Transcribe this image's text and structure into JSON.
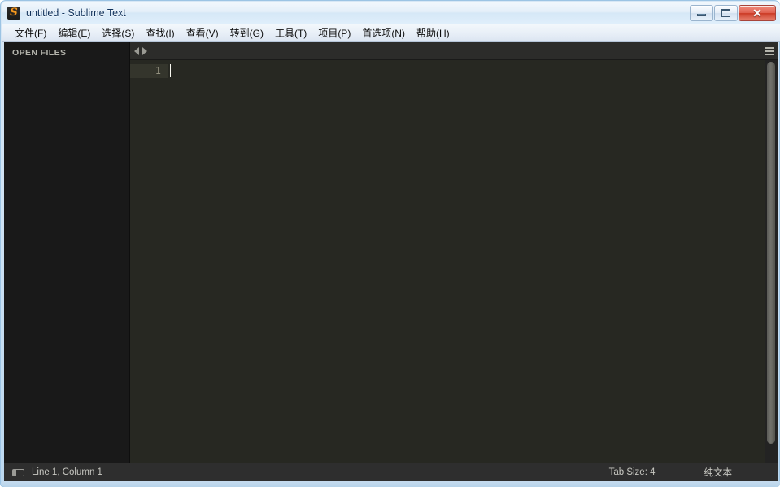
{
  "window": {
    "title": "untitled - Sublime Text",
    "app_icon": "sublime-text-logo",
    "controls": {
      "minimize_label": "–",
      "maximize_label": "□",
      "close_label": "✕"
    }
  },
  "menubar": {
    "items": [
      {
        "label": "文件(F)"
      },
      {
        "label": "编辑(E)"
      },
      {
        "label": "选择(S)"
      },
      {
        "label": "查找(I)"
      },
      {
        "label": "查看(V)"
      },
      {
        "label": "转到(G)"
      },
      {
        "label": "工具(T)"
      },
      {
        "label": "项目(P)"
      },
      {
        "label": "首选项(N)"
      },
      {
        "label": "帮助(H)"
      }
    ]
  },
  "sidebar": {
    "header": "OPEN FILES",
    "items": []
  },
  "tabbar": {
    "scroll_left_icon": "triangle-left-icon",
    "scroll_right_icon": "triangle-right-icon",
    "menu_icon": "hamburger-menu-icon",
    "tabs": []
  },
  "editor": {
    "lines": [
      {
        "number": "1",
        "text": "",
        "active": true
      }
    ],
    "background_color": "#272822",
    "active_line_color": "#34352c",
    "gutter_text_color": "#93917f"
  },
  "statusbar": {
    "sidebar_toggle_icon": "sidebar-toggle-icon",
    "cursor_position": "Line 1, Column 1",
    "tab_size": "Tab Size: 4",
    "syntax": "纯文本"
  }
}
